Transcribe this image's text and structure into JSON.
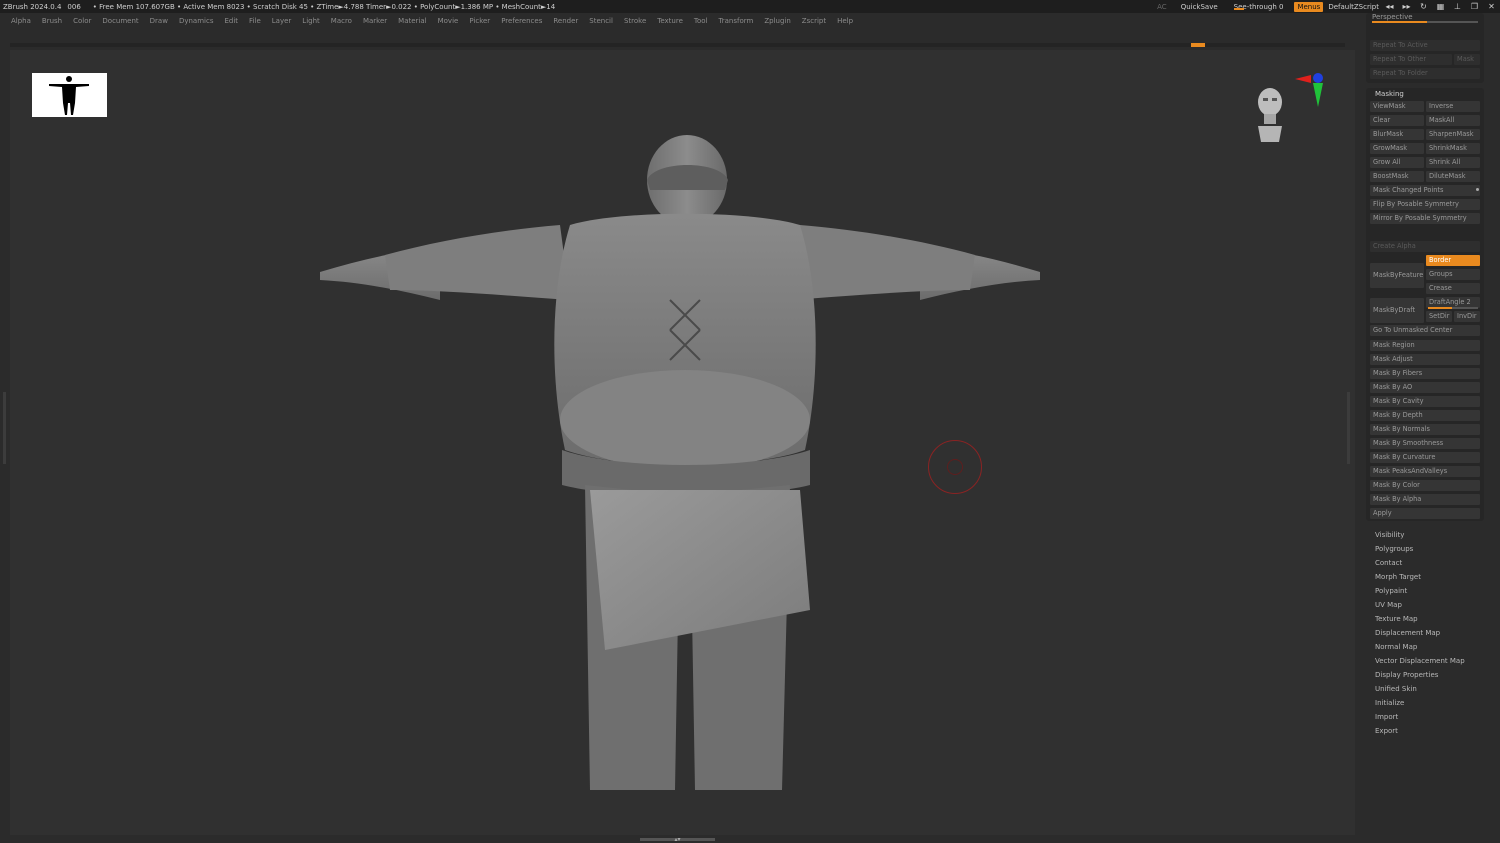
{
  "titlebar": {
    "app_title": "ZBrush 2024.0.4",
    "version_tag": "006",
    "stats": "• Free Mem 107.607GB • Active Mem 8023 • Scratch Disk 45 • ZTime►4.788 Timer►0.022 • PolyCount►1.386 MP • MeshCount►14",
    "ac_label": "AC",
    "quicksave_label": "QuickSave",
    "seethrough_label": "See-through  0",
    "menus_label": "Menus",
    "script_label": "DefaultZScript",
    "icons": [
      "double-arrow-left-icon",
      "double-arrow-right-icon",
      "refresh-icon",
      "layout-icon",
      "minimize-icon",
      "restore-icon",
      "close-icon"
    ],
    "icon_glyphs": [
      "◂◂",
      "▸▸",
      "↻",
      "▦",
      "⊥",
      "❐",
      "✕"
    ]
  },
  "menubar": {
    "items": [
      "Alpha",
      "Brush",
      "Color",
      "Document",
      "Draw",
      "Dynamics",
      "Edit",
      "File",
      "Layer",
      "Light",
      "Macro",
      "Marker",
      "Material",
      "Movie",
      "Picker",
      "Preferences",
      "Render",
      "Stencil",
      "Stroke",
      "Texture",
      "Tool",
      "Transform",
      "Zplugin",
      "Zscript",
      "Help"
    ]
  },
  "panel_top": {
    "perspective_label": "Perspective",
    "repeat_to_active": "Repeat To Active",
    "repeat_to_other": "Repeat To Other",
    "mask_label": "Mask",
    "repeat_to_folder": "Repeat To Folder"
  },
  "masking": {
    "title": "Masking",
    "view_mask": "ViewMask",
    "inverse": "Inverse",
    "clear": "Clear",
    "mask_all": "MaskAll",
    "blur_mask": "BlurMask",
    "sharpen_mask": "SharpenMask",
    "grow_mask": "GrowMask",
    "shrink_mask": "ShrinkMask",
    "grow_all": "Grow All",
    "shrink_all": "Shrink All",
    "boost_mask": "BoostMask",
    "dilute_mask": "DiluteMask",
    "mask_changed_points": "Mask Changed Points",
    "flip_by_posable_symmetry": "Flip By Posable Symmetry",
    "mirror_by_posable_symmetry": "Mirror By Posable Symmetry",
    "create_alpha": "Create Alpha",
    "mask_by_feature": "MaskByFeature",
    "border": "Border",
    "groups": "Groups",
    "crease": "Crease",
    "mask_by_draft": "MaskByDraft",
    "draft_angle": "DraftAngle  2",
    "set_dir": "SetDir",
    "inv_dir": "InvDir",
    "go_to_unmasked_center": "Go To Unmasked Center",
    "mask_region": "Mask Region",
    "mask_adjust": "Mask Adjust",
    "mask_by_fibers": "Mask By Fibers",
    "mask_by_ao": "Mask By AO",
    "mask_by_cavity": "Mask By Cavity",
    "mask_by_depth": "Mask By Depth",
    "mask_by_normals": "Mask By Normals",
    "mask_by_smoothness": "Mask By Smoothness",
    "mask_by_curvature": "Mask By Curvature",
    "mask_peaks_and_valleys": "Mask PeaksAndValleys",
    "mask_by_color": "Mask By Color",
    "mask_by_alpha": "Mask By Alpha",
    "apply": "Apply"
  },
  "sections": {
    "items": [
      "Visibility",
      "Polygroups",
      "Contact",
      "Morph Target",
      "Polypaint",
      "UV Map",
      "Texture Map",
      "Displacement Map",
      "Normal Map",
      "Vector Displacement Map",
      "Display Properties",
      "Unified Skin",
      "Initialize",
      "Import",
      "Export"
    ]
  },
  "bottom_handle": "▴▾",
  "colors": {
    "accent": "#e98a1f",
    "axis_x": "#e0201c",
    "axis_y": "#20c23a",
    "axis_z": "#2040e0"
  }
}
